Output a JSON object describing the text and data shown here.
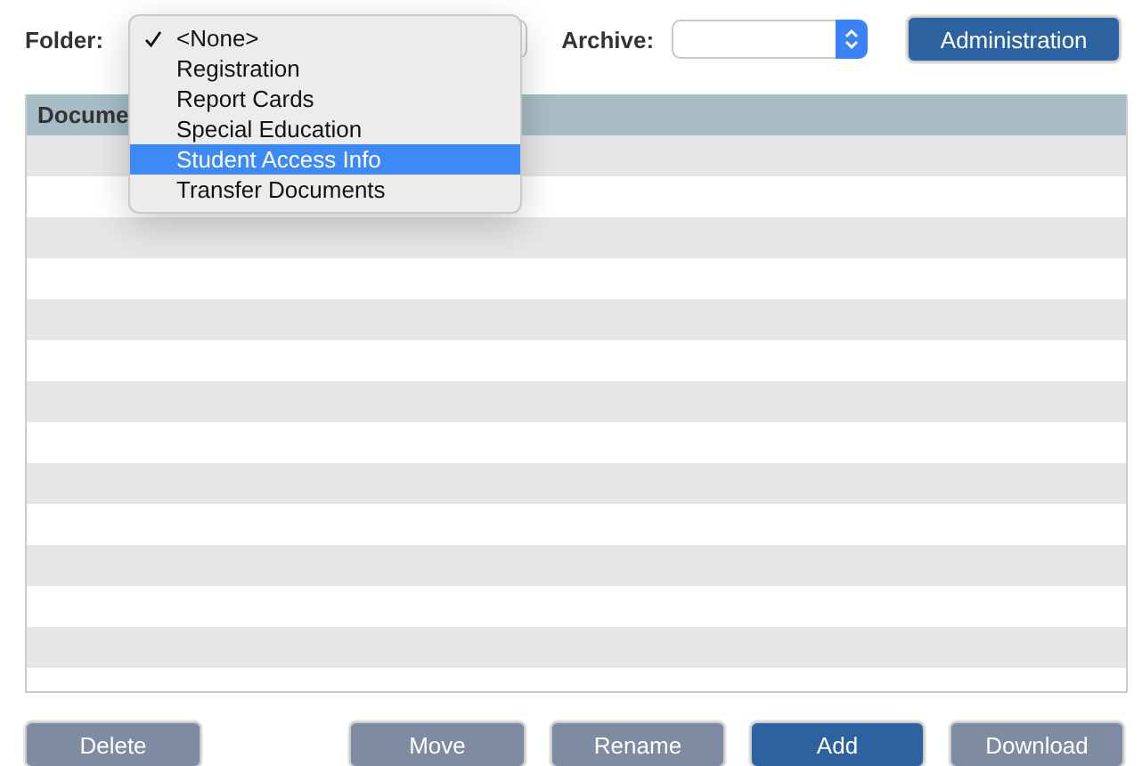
{
  "toolbar": {
    "folder_label": "Folder:",
    "archive_label": "Archive:",
    "administration_button": {
      "label": "Administration",
      "kind": "primary"
    }
  },
  "folder_menu": [
    {
      "label": "<None>",
      "checked": true,
      "selected": false
    },
    {
      "label": "Registration",
      "checked": false,
      "selected": false
    },
    {
      "label": "Report Cards",
      "checked": false,
      "selected": false
    },
    {
      "label": "Special Education",
      "checked": false,
      "selected": false
    },
    {
      "label": "Student Access Info",
      "checked": false,
      "selected": true
    },
    {
      "label": "Transfer Documents",
      "checked": false,
      "selected": false
    }
  ],
  "table": {
    "columns": [
      "Docume"
    ]
  },
  "buttons": [
    {
      "label": "Delete",
      "kind": "secondary"
    },
    {
      "label": "Move",
      "kind": "secondary"
    },
    {
      "label": "Rename",
      "kind": "secondary"
    },
    {
      "label": "Add",
      "kind": "primary"
    },
    {
      "label": "Download",
      "kind": "secondary"
    }
  ]
}
